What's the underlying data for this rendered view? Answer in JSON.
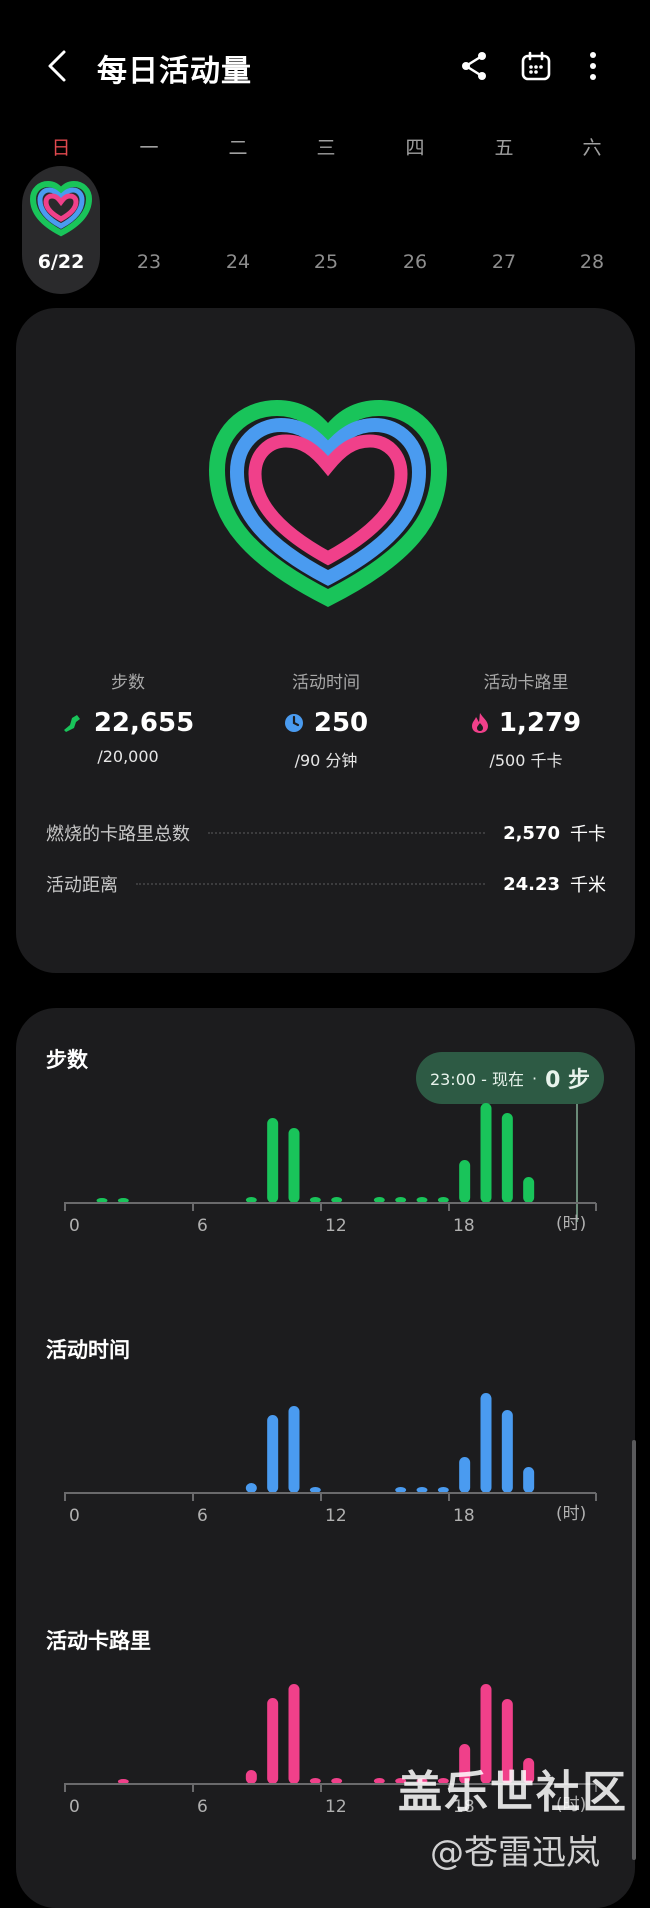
{
  "header": {
    "title": "每日活动量",
    "back_icon": "chevron-left-icon",
    "share_icon": "share-icon",
    "calendar_icon": "calendar-icon",
    "more_icon": "more-vertical-icon"
  },
  "week": [
    {
      "name": "日",
      "date": "6/22",
      "selected": true
    },
    {
      "name": "一",
      "date": "23"
    },
    {
      "name": "二",
      "date": "24"
    },
    {
      "name": "三",
      "date": "25"
    },
    {
      "name": "四",
      "date": "26"
    },
    {
      "name": "五",
      "date": "27"
    },
    {
      "name": "六",
      "date": "28"
    }
  ],
  "summary": {
    "steps": {
      "label": "步数",
      "value": "22,655",
      "goal": "/20,000",
      "icon": "shoe-icon",
      "color": "#19c45a"
    },
    "active_time": {
      "label": "活动时间",
      "value": "250",
      "goal": "/90 分钟",
      "icon": "clock-icon",
      "color": "#4a9bf0"
    },
    "calories": {
      "label": "活动卡路里",
      "value": "1,279",
      "goal": "/500 千卡",
      "icon": "flame-icon",
      "color": "#f0408a"
    },
    "total_calories": {
      "label": "燃烧的卡路里总数",
      "value": "2,570",
      "unit": "千卡"
    },
    "distance": {
      "label": "活动距离",
      "value": "24.23",
      "unit": "千米"
    }
  },
  "charts": {
    "steps": {
      "title": "步数",
      "tooltip_time": "23:00 - 现在",
      "tooltip_value": "0 步"
    },
    "active_time": {
      "title": "活动时间"
    },
    "calories": {
      "title": "活动卡路里"
    }
  },
  "chart_data": [
    {
      "type": "bar",
      "title": "步数",
      "color": "#19c45a",
      "x": [
        0,
        1,
        2,
        3,
        4,
        5,
        6,
        7,
        8,
        9,
        10,
        11,
        12,
        13,
        14,
        15,
        16,
        17,
        18,
        19,
        20,
        21,
        22,
        23
      ],
      "values": [
        0,
        0.04,
        0.04,
        0,
        0,
        0,
        0,
        0,
        0.06,
        0.85,
        0.75,
        0.06,
        0.06,
        0,
        0.06,
        0.06,
        0.06,
        0.06,
        0.43,
        1.0,
        0.9,
        0.26,
        0,
        0
      ],
      "xticks": [
        "0",
        "6",
        "12",
        "18"
      ],
      "xunit": "(时)"
    },
    {
      "type": "bar",
      "title": "活动时间",
      "color": "#4a9bf0",
      "x": [
        0,
        1,
        2,
        3,
        4,
        5,
        6,
        7,
        8,
        9,
        10,
        11,
        12,
        13,
        14,
        15,
        16,
        17,
        18,
        19,
        20,
        21,
        22,
        23
      ],
      "values": [
        0,
        0,
        0,
        0,
        0,
        0,
        0,
        0,
        0.1,
        0.78,
        0.87,
        0.06,
        0,
        0,
        0,
        0.06,
        0.06,
        0.06,
        0.36,
        1.0,
        0.83,
        0.26,
        0,
        0
      ],
      "xticks": [
        "0",
        "6",
        "12",
        "18"
      ],
      "xunit": "(时)"
    },
    {
      "type": "bar",
      "title": "活动卡路里",
      "color": "#f0408a",
      "x": [
        0,
        1,
        2,
        3,
        4,
        5,
        6,
        7,
        8,
        9,
        10,
        11,
        12,
        13,
        14,
        15,
        16,
        17,
        18,
        19,
        20,
        21,
        22,
        23
      ],
      "values": [
        0,
        0,
        0.05,
        0,
        0,
        0,
        0,
        0,
        0.14,
        0.86,
        1.0,
        0.06,
        0.06,
        0,
        0.06,
        0.06,
        0.06,
        0.06,
        0.4,
        1.0,
        0.85,
        0.26,
        0,
        0
      ],
      "xticks": [
        "0",
        "6",
        "12",
        "18"
      ],
      "xunit": "(时)"
    }
  ],
  "watermark": {
    "line1": "盖乐世社区",
    "line2": "@苍雷迅岚"
  }
}
